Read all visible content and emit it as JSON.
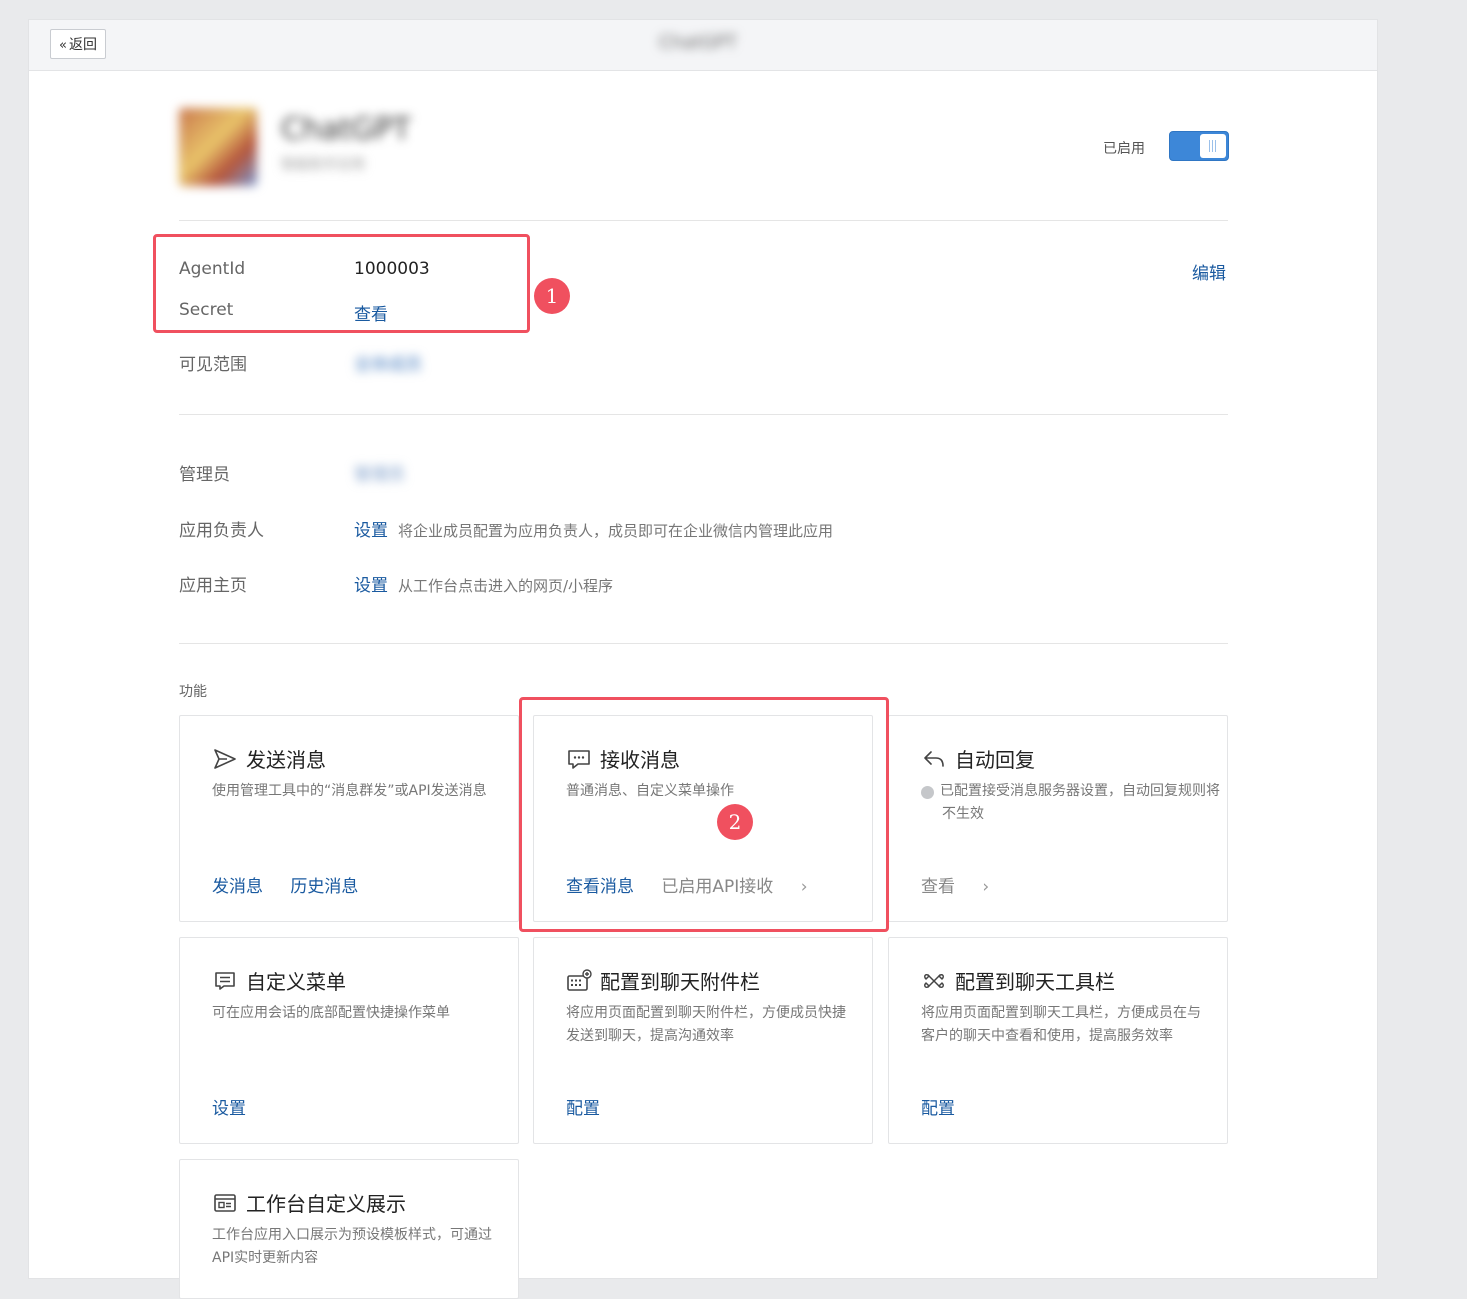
{
  "topbar": {
    "back_label": "返回",
    "title": "ChatGPT"
  },
  "app": {
    "name": "ChatGPT",
    "subtitle": "智能助手应用",
    "status_label": "已启用",
    "enabled": true
  },
  "credentials": {
    "agentid_label": "AgentId",
    "agentid_value": "1000003",
    "secret_label": "Secret",
    "secret_link": "查看",
    "edit_link": "编辑"
  },
  "visibility": {
    "label": "可见范围",
    "value": "全体成员"
  },
  "management": {
    "admin_label": "管理员",
    "admin_value": "管理员",
    "owner_label": "应用负责人",
    "owner_link": "设置",
    "owner_hint": "将企业成员配置为应用负责人，成员即可在企业微信内管理此应用",
    "homepage_label": "应用主页",
    "homepage_link": "设置",
    "homepage_hint": "从工作台点击进入的网页/小程序"
  },
  "annotations": {
    "badge1": "1",
    "badge2": "2"
  },
  "features": {
    "section_title": "功能",
    "cards": [
      {
        "icon": "send-icon",
        "title": "发送消息",
        "desc": "使用管理工具中的“消息群发”或API发送消息",
        "actions": [
          "发消息",
          "历史消息"
        ]
      },
      {
        "icon": "chat-bubble-icon",
        "title": "接收消息",
        "desc": "普通消息、自定义菜单操作",
        "actions": [
          "查看消息",
          "已启用API接收"
        ]
      },
      {
        "icon": "reply-icon",
        "title": "自动回复",
        "desc": "已配置接受消息服务器设置，自动回复规则将不生效",
        "actions": [
          "查看"
        ]
      },
      {
        "icon": "menu-icon",
        "title": "自定义菜单",
        "desc": "可在应用会话的底部配置快捷操作菜单",
        "actions": [
          "设置"
        ]
      },
      {
        "icon": "keyboard-plus-icon",
        "title": "配置到聊天附件栏",
        "desc": "将应用页面配置到聊天附件栏，方便成员快捷发送到聊天，提高沟通效率",
        "actions": [
          "配置"
        ]
      },
      {
        "icon": "toolbar-icon",
        "title": "配置到聊天工具栏",
        "desc": "将应用页面配置到聊天工具栏，方便成员在与客户的聊天中查看和使用，提高服务效率",
        "actions": [
          "配置"
        ]
      },
      {
        "icon": "card-layout-icon",
        "title": "工作台自定义展示",
        "desc": "工作台应用入口展示为预设模板样式，可通过API实时更新内容",
        "actions": []
      }
    ]
  }
}
